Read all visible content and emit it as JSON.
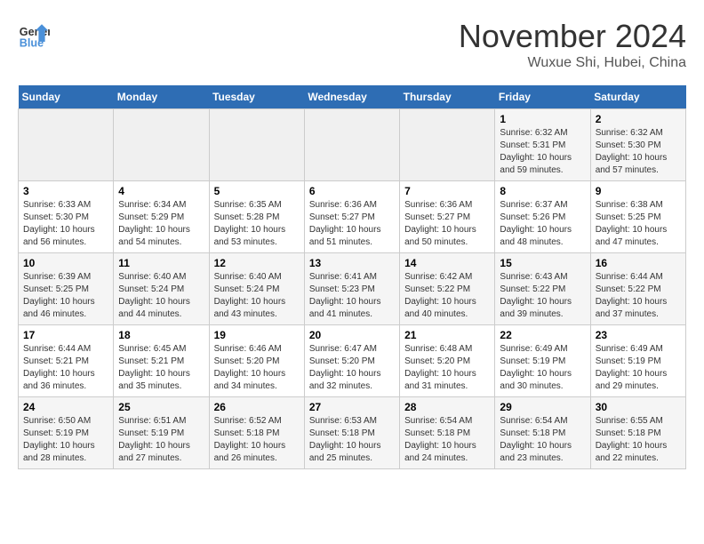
{
  "logo": {
    "line1": "General",
    "line2": "Blue"
  },
  "title": "November 2024",
  "subtitle": "Wuxue Shi, Hubei, China",
  "weekdays": [
    "Sunday",
    "Monday",
    "Tuesday",
    "Wednesday",
    "Thursday",
    "Friday",
    "Saturday"
  ],
  "weeks": [
    [
      {
        "day": "",
        "info": ""
      },
      {
        "day": "",
        "info": ""
      },
      {
        "day": "",
        "info": ""
      },
      {
        "day": "",
        "info": ""
      },
      {
        "day": "",
        "info": ""
      },
      {
        "day": "1",
        "info": "Sunrise: 6:32 AM\nSunset: 5:31 PM\nDaylight: 10 hours and 59 minutes."
      },
      {
        "day": "2",
        "info": "Sunrise: 6:32 AM\nSunset: 5:30 PM\nDaylight: 10 hours and 57 minutes."
      }
    ],
    [
      {
        "day": "3",
        "info": "Sunrise: 6:33 AM\nSunset: 5:30 PM\nDaylight: 10 hours and 56 minutes."
      },
      {
        "day": "4",
        "info": "Sunrise: 6:34 AM\nSunset: 5:29 PM\nDaylight: 10 hours and 54 minutes."
      },
      {
        "day": "5",
        "info": "Sunrise: 6:35 AM\nSunset: 5:28 PM\nDaylight: 10 hours and 53 minutes."
      },
      {
        "day": "6",
        "info": "Sunrise: 6:36 AM\nSunset: 5:27 PM\nDaylight: 10 hours and 51 minutes."
      },
      {
        "day": "7",
        "info": "Sunrise: 6:36 AM\nSunset: 5:27 PM\nDaylight: 10 hours and 50 minutes."
      },
      {
        "day": "8",
        "info": "Sunrise: 6:37 AM\nSunset: 5:26 PM\nDaylight: 10 hours and 48 minutes."
      },
      {
        "day": "9",
        "info": "Sunrise: 6:38 AM\nSunset: 5:25 PM\nDaylight: 10 hours and 47 minutes."
      }
    ],
    [
      {
        "day": "10",
        "info": "Sunrise: 6:39 AM\nSunset: 5:25 PM\nDaylight: 10 hours and 46 minutes."
      },
      {
        "day": "11",
        "info": "Sunrise: 6:40 AM\nSunset: 5:24 PM\nDaylight: 10 hours and 44 minutes."
      },
      {
        "day": "12",
        "info": "Sunrise: 6:40 AM\nSunset: 5:24 PM\nDaylight: 10 hours and 43 minutes."
      },
      {
        "day": "13",
        "info": "Sunrise: 6:41 AM\nSunset: 5:23 PM\nDaylight: 10 hours and 41 minutes."
      },
      {
        "day": "14",
        "info": "Sunrise: 6:42 AM\nSunset: 5:22 PM\nDaylight: 10 hours and 40 minutes."
      },
      {
        "day": "15",
        "info": "Sunrise: 6:43 AM\nSunset: 5:22 PM\nDaylight: 10 hours and 39 minutes."
      },
      {
        "day": "16",
        "info": "Sunrise: 6:44 AM\nSunset: 5:22 PM\nDaylight: 10 hours and 37 minutes."
      }
    ],
    [
      {
        "day": "17",
        "info": "Sunrise: 6:44 AM\nSunset: 5:21 PM\nDaylight: 10 hours and 36 minutes."
      },
      {
        "day": "18",
        "info": "Sunrise: 6:45 AM\nSunset: 5:21 PM\nDaylight: 10 hours and 35 minutes."
      },
      {
        "day": "19",
        "info": "Sunrise: 6:46 AM\nSunset: 5:20 PM\nDaylight: 10 hours and 34 minutes."
      },
      {
        "day": "20",
        "info": "Sunrise: 6:47 AM\nSunset: 5:20 PM\nDaylight: 10 hours and 32 minutes."
      },
      {
        "day": "21",
        "info": "Sunrise: 6:48 AM\nSunset: 5:20 PM\nDaylight: 10 hours and 31 minutes."
      },
      {
        "day": "22",
        "info": "Sunrise: 6:49 AM\nSunset: 5:19 PM\nDaylight: 10 hours and 30 minutes."
      },
      {
        "day": "23",
        "info": "Sunrise: 6:49 AM\nSunset: 5:19 PM\nDaylight: 10 hours and 29 minutes."
      }
    ],
    [
      {
        "day": "24",
        "info": "Sunrise: 6:50 AM\nSunset: 5:19 PM\nDaylight: 10 hours and 28 minutes."
      },
      {
        "day": "25",
        "info": "Sunrise: 6:51 AM\nSunset: 5:19 PM\nDaylight: 10 hours and 27 minutes."
      },
      {
        "day": "26",
        "info": "Sunrise: 6:52 AM\nSunset: 5:18 PM\nDaylight: 10 hours and 26 minutes."
      },
      {
        "day": "27",
        "info": "Sunrise: 6:53 AM\nSunset: 5:18 PM\nDaylight: 10 hours and 25 minutes."
      },
      {
        "day": "28",
        "info": "Sunrise: 6:54 AM\nSunset: 5:18 PM\nDaylight: 10 hours and 24 minutes."
      },
      {
        "day": "29",
        "info": "Sunrise: 6:54 AM\nSunset: 5:18 PM\nDaylight: 10 hours and 23 minutes."
      },
      {
        "day": "30",
        "info": "Sunrise: 6:55 AM\nSunset: 5:18 PM\nDaylight: 10 hours and 22 minutes."
      }
    ]
  ]
}
